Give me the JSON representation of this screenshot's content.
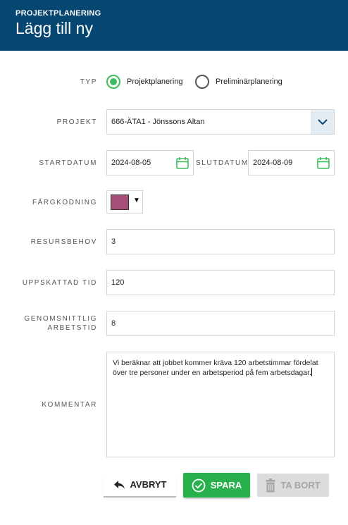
{
  "header": {
    "eyebrow": "PROJEKTPLANERING",
    "title": "Lägg till ny"
  },
  "form": {
    "typ": {
      "label": "TYP",
      "options": [
        "Projektplanering",
        "Preliminärplanering"
      ],
      "selected": "Projektplanering"
    },
    "projekt": {
      "label": "PROJEKT",
      "value": "666-ÄTA1 - Jönssons Altan"
    },
    "startdatum": {
      "label": "STARTDATUM",
      "value": "2024-08-05"
    },
    "slutdatum": {
      "label": "SLUTDATUM",
      "value": "2024-08-09"
    },
    "fargkodning": {
      "label": "FÄRGKODNING",
      "color": "#a64d79"
    },
    "resursbehov": {
      "label": "RESURSBEHOV",
      "value": "3"
    },
    "uppskattad_tid": {
      "label": "UPPSKATTAD TID",
      "value": "120"
    },
    "genomsnittlig_arbetstid": {
      "label_line1": "GENOMSNITTLIG",
      "label_line2": "ARBETSTID",
      "value": "8"
    },
    "kommentar": {
      "label": "KOMMENTAR",
      "value": "Vi beräknar att jobbet kommer kräva 120 arbetstimmar fördelat över tre personer under en arbetsperiod på fem arbetsdagar."
    }
  },
  "actions": {
    "cancel_label": "AVBRYT",
    "save_label": "SPARA",
    "delete_label": "TA BORT"
  },
  "colors": {
    "header_bg": "#064772",
    "accent_green": "#27b04b",
    "radio_green": "#3dbd5d"
  },
  "icons": {
    "dropdown": "chevron-down-icon",
    "date": "calendar-icon",
    "cancel": "undo-arrow-icon",
    "save": "check-circle-icon",
    "delete": "trash-icon"
  }
}
